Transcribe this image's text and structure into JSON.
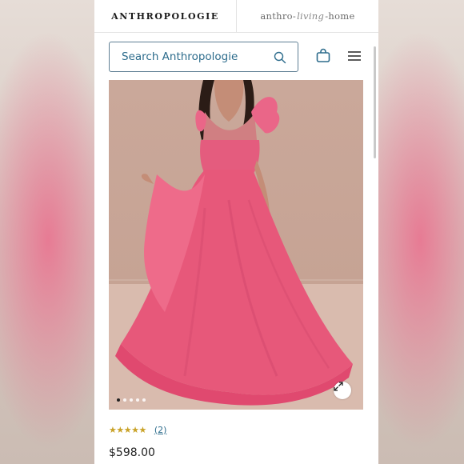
{
  "header": {
    "brand": "ANTHROPOLOGIE",
    "home_brand_prefix": "anthro-",
    "home_brand_script": "living",
    "home_brand_suffix": "-home"
  },
  "search": {
    "placeholder": "Search Anthropologie",
    "value": ""
  },
  "icons": {
    "search": "search-icon",
    "bag": "shopping-bag-icon",
    "menu": "hamburger-menu-icon",
    "expand": "expand-icon"
  },
  "product": {
    "rating": {
      "stars": "★★★★★",
      "value": 5,
      "review_count": "(2)"
    },
    "price": "$598.00",
    "gallery": {
      "image_count": 5,
      "active_index": 0
    }
  },
  "colors": {
    "accent": "#2d6c8c",
    "star": "#c9a227",
    "dress": "#e7587a"
  }
}
